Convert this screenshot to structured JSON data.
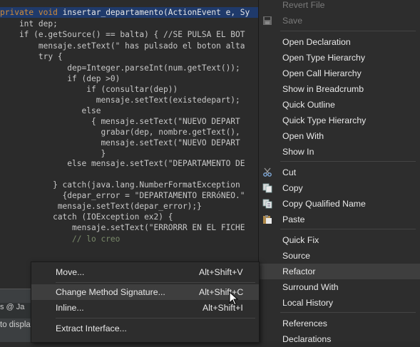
{
  "editor": {
    "lines": [
      "private void insertar_departamento(ActionEvent e, Sy",
      "    int dep;",
      "    if (e.getSource() == balta) { //SE PULSA EL BOT",
      "        mensaje.setText(\" has pulsado el boton alta",
      "        try {",
      "              dep=Integer.parseInt(num.getText());",
      "              if (dep >0)",
      "                  if (consultar(dep))",
      "                    mensaje.setText(existedepart);",
      "                 else",
      "                   { mensaje.setText(\"NUEVO DEPART",
      "                     grabar(dep, nombre.getText(),",
      "                     mensaje.setText(\"NUEVO DEPART",
      "                     }",
      "              else mensaje.setText(\"DEPARTAMENTO DE",
      "",
      "           } catch(java.lang.NumberFormatException",
      "             {depar_error = \"DEPARTAMENTO ERRóNEO.\"",
      "            mensaje.setText(depar_error);}",
      "           catch (IOException ex2) {",
      "               mensaje.setText(\"ERRORRR EN EL FICHE",
      "               // lo creo"
    ]
  },
  "bottom": {
    "tabs": "s  @ Ja",
    "status": "to displa"
  },
  "context_menu": {
    "items": [
      {
        "label": "Revert File",
        "disabled": true,
        "icon": ""
      },
      {
        "label": "Save",
        "disabled": true,
        "icon": "save-icon"
      },
      {
        "label": "Open Declaration"
      },
      {
        "label": "Open Type Hierarchy"
      },
      {
        "label": "Open Call Hierarchy"
      },
      {
        "label": "Show in Breadcrumb"
      },
      {
        "label": "Quick Outline"
      },
      {
        "label": "Quick Type Hierarchy"
      },
      {
        "label": "Open With"
      },
      {
        "label": "Show In"
      },
      {
        "label": "Cut",
        "icon": "scissors-icon"
      },
      {
        "label": "Copy",
        "icon": "copy-icon"
      },
      {
        "label": "Copy Qualified Name",
        "icon": "copy-qualified-icon"
      },
      {
        "label": "Paste",
        "icon": "paste-icon"
      },
      {
        "label": "Quick Fix"
      },
      {
        "label": "Source"
      },
      {
        "label": "Refactor",
        "active": true
      },
      {
        "label": "Surround With"
      },
      {
        "label": "Local History"
      },
      {
        "label": "References"
      },
      {
        "label": "Declarations"
      }
    ]
  },
  "refactor_submenu": {
    "items": [
      {
        "label": "Move...",
        "shortcut": "Alt+Shift+V"
      },
      {
        "label": "Change Method Signature...",
        "shortcut": "Alt+Shift+C",
        "active": true
      },
      {
        "label": "Inline...",
        "shortcut": "Alt+Shift+I"
      },
      {
        "label": "Extract Interface...",
        "shortcut": ""
      }
    ]
  },
  "colors": {
    "menu_bg": "#2d2d2d",
    "menu_highlight": "#3e3e3e",
    "editor_bg": "#2b2b2b",
    "line_highlight": "#1f3a6b"
  }
}
